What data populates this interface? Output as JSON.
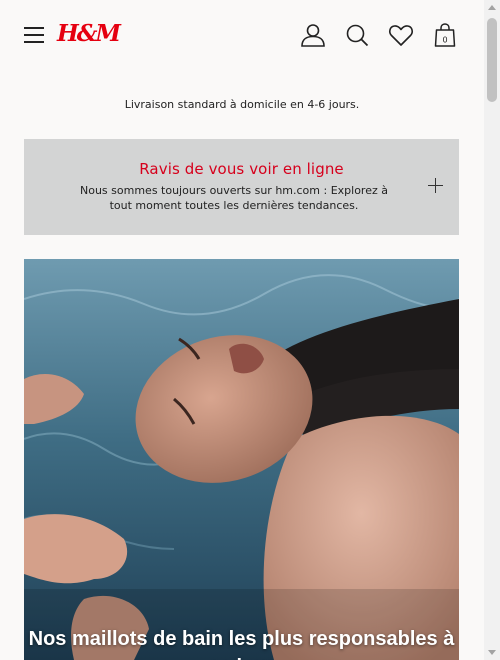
{
  "header": {
    "logo": "H&M",
    "icons": [
      "menu-icon",
      "account-icon",
      "search-icon",
      "favorites-icon",
      "shopping-bag-icon"
    ],
    "cart_count": "0"
  },
  "delivery_banner": "Livraison standard à domicile en 4-6 jours.",
  "promo": {
    "title": "Ravis de vous voir en ligne",
    "text": "Nous sommes toujours ouverts sur hm.com : Explorez à tout moment toutes les dernières tendances."
  },
  "hero": {
    "caption": "Nos maillots de bain les plus responsables à ce jour"
  },
  "colors": {
    "brand_red": "#e50010",
    "promo_title": "#d6001c",
    "promo_bg": "#d3d4d4",
    "page_bg": "#faf9f8"
  }
}
